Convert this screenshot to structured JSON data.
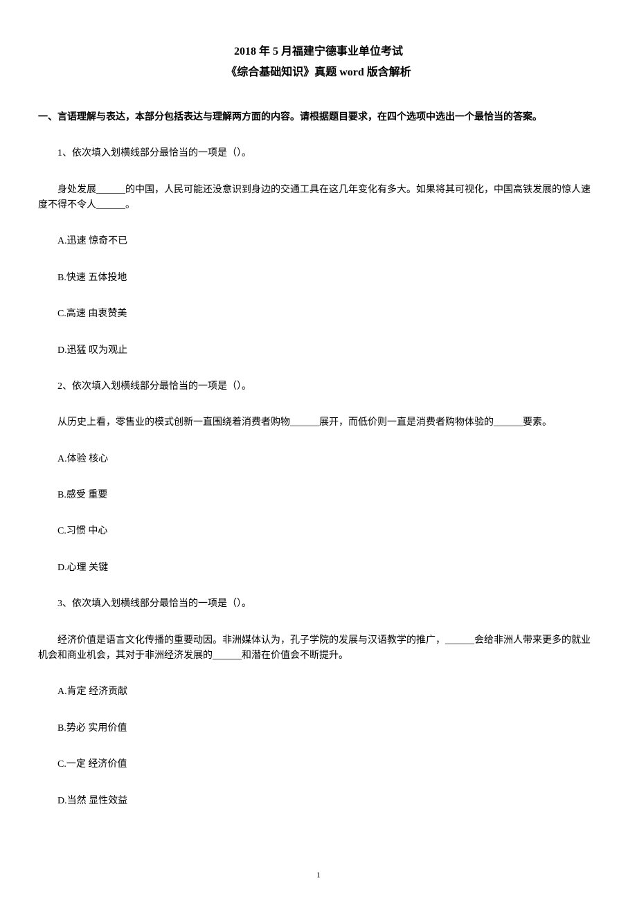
{
  "title": {
    "line1": "2018 年 5 月福建宁德事业单位考试",
    "line2": "《综合基础知识》真题 word 版含解析"
  },
  "section_heading": "一、言语理解与表达，本部分包括表达与理解两方面的内容。请根据题目要求，在四个选项中选出一个最恰当的答案。",
  "q1": {
    "stem": "1、依次填入划横线部分最恰当的一项是（）。",
    "passage": "身处发展______的中国，人民可能还没意识到身边的交通工具在这几年变化有多大。如果将其可视化，中国高铁发展的惊人速度不得不令人______。",
    "optA": "A.迅速 惊奇不已",
    "optB": "B.快速 五体投地",
    "optC": "C.高速 由衷赞美",
    "optD": "D.迅猛 叹为观止"
  },
  "q2": {
    "stem": "2、依次填入划横线部分最恰当的一项是（）。",
    "passage": "从历史上看，零售业的模式创新一直围绕着消费者购物______展开，而低价则一直是消费者购物体验的______要素。",
    "optA": "A.体验 核心",
    "optB": "B.感受 重要",
    "optC": "C.习惯 中心",
    "optD": "D.心理 关键"
  },
  "q3": {
    "stem": "3、依次填入划横线部分最恰当的一项是（）。",
    "passage": "经济价值是语言文化传播的重要动因。非洲媒体认为，孔子学院的发展与汉语教学的推广，______会给非洲人带来更多的就业机会和商业机会，其对于非洲经济发展的______和潜在价值会不断提升。",
    "optA": "A.肯定 经济贡献",
    "optB": "B.势必 实用价值",
    "optC": "C.一定 经济价值",
    "optD": "D.当然 显性效益"
  },
  "page_number": "1"
}
